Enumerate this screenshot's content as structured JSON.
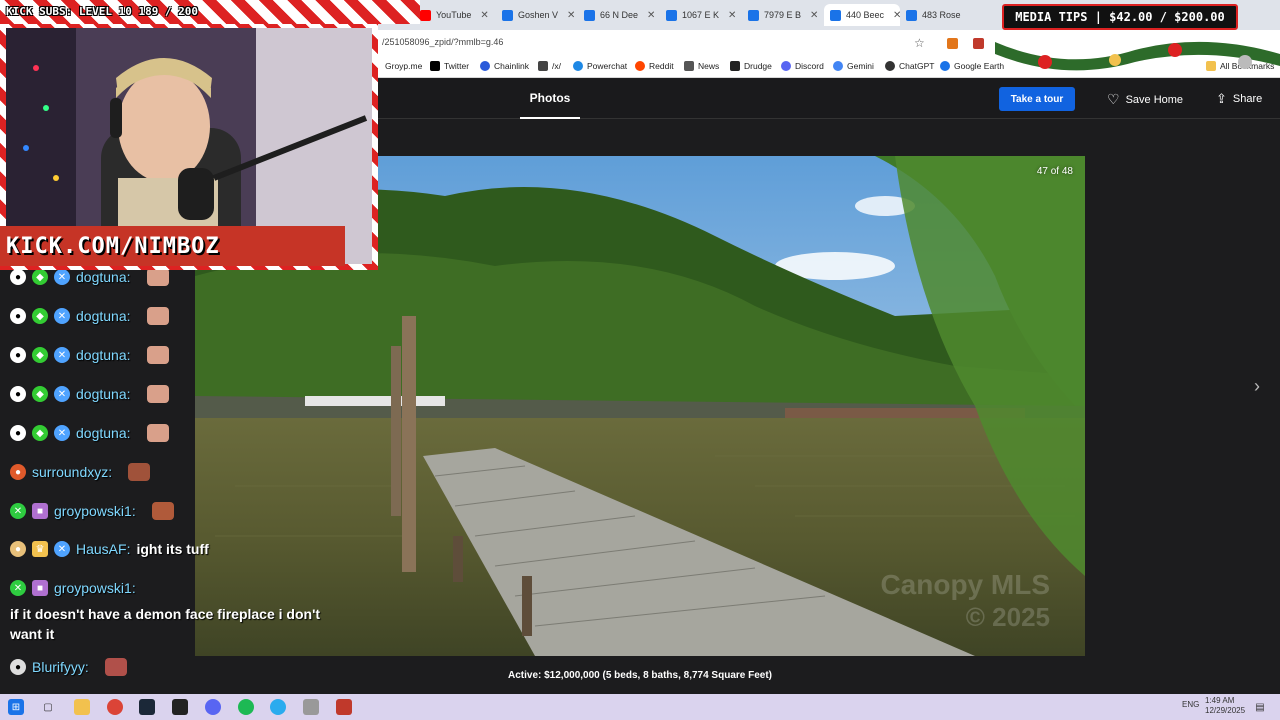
{
  "browser": {
    "tabs": [
      {
        "label": "YouTube",
        "color": "#ff0000"
      },
      {
        "label": "Goshen V",
        "color": "#1a73e8"
      },
      {
        "label": "66 N Dee",
        "color": "#1a73e8"
      },
      {
        "label": "1067 E K",
        "color": "#1a73e8"
      },
      {
        "label": "7979 E B",
        "color": "#1a73e8"
      },
      {
        "label": "440 Beec",
        "color": "#1a73e8"
      },
      {
        "label": "483 Rose",
        "color": "#1a73e8"
      }
    ],
    "url": "/251058096_zpid/?mmlb=g.46",
    "bookmarks": [
      {
        "label": "Groyp.me",
        "color": "#888888"
      },
      {
        "label": "Twitter",
        "color": "#000000"
      },
      {
        "label": "Chainlink",
        "color": "#2a5ada"
      },
      {
        "label": "/x/",
        "color": "#444444"
      },
      {
        "label": "Powerchat",
        "color": "#1e88e5"
      },
      {
        "label": "Reddit",
        "color": "#ff4500"
      },
      {
        "label": "News",
        "color": "#555555"
      },
      {
        "label": "Drudge",
        "color": "#222222"
      },
      {
        "label": "Discord",
        "color": "#5865f2"
      },
      {
        "label": "Gemini",
        "color": "#4285f4"
      },
      {
        "label": "ChatGPT",
        "color": "#333333"
      },
      {
        "label": "Google Earth",
        "color": "#1a73e8"
      },
      {
        "label": "All Bookmarks",
        "color": "#f2c14e"
      }
    ]
  },
  "listing": {
    "photos_tab": "Photos",
    "take_tour": "Take a tour",
    "save_home": "Save Home",
    "share": "Share",
    "photo_counter": "47 of 48",
    "caption": "Active: $12,000,000 (5 beds, 8 baths, 8,774 Square Feet)",
    "photo_watermark_line1": "Canopy MLS",
    "photo_watermark_line2": "© 2025"
  },
  "overlay": {
    "subs": "KICK SUBS: LEVEL 10 189 / 200",
    "kick_url": "KICK.COM/NIMBOZ",
    "media_tips": "MEDIA TIPS | $42.00 / $200.00"
  },
  "chat": {
    "messages": [
      {
        "user": "dogtuna:",
        "text": "",
        "badges": [
          "#ffffff",
          "#33cc33",
          "#4fa3ff"
        ]
      },
      {
        "user": "dogtuna:",
        "text": "",
        "badges": [
          "#ffffff",
          "#33cc33",
          "#4fa3ff"
        ]
      },
      {
        "user": "dogtuna:",
        "text": "",
        "badges": [
          "#ffffff",
          "#33cc33",
          "#4fa3ff"
        ]
      },
      {
        "user": "dogtuna:",
        "text": "",
        "badges": [
          "#ffffff",
          "#33cc33",
          "#4fa3ff"
        ]
      },
      {
        "user": "dogtuna:",
        "text": "",
        "badges": [
          "#ffffff",
          "#33cc33",
          "#4fa3ff"
        ]
      },
      {
        "user": "surroundxyz:",
        "text": "",
        "badges": [
          "#e05a2b"
        ]
      },
      {
        "user": "groypowski1:",
        "text": "",
        "badges": [
          "#2ecc40",
          "#b070d0"
        ]
      },
      {
        "user": "HausAF:",
        "text": "ight its tuff",
        "badges": [
          "#e8c07a",
          "#f2c14e",
          "#4fa3ff"
        ]
      },
      {
        "user": "groypowski1:",
        "text": "",
        "badges": [
          "#2ecc40",
          "#b070d0"
        ]
      },
      {
        "user": "Blurifyyy:",
        "text": "",
        "badges": [
          "#dddddd"
        ]
      }
    ],
    "multiline": "if it doesn't have a demon face fireplace i don't want it"
  },
  "taskbar": {
    "lang": "ENG",
    "time": "1:49 AM",
    "date": "12/29/2025"
  }
}
